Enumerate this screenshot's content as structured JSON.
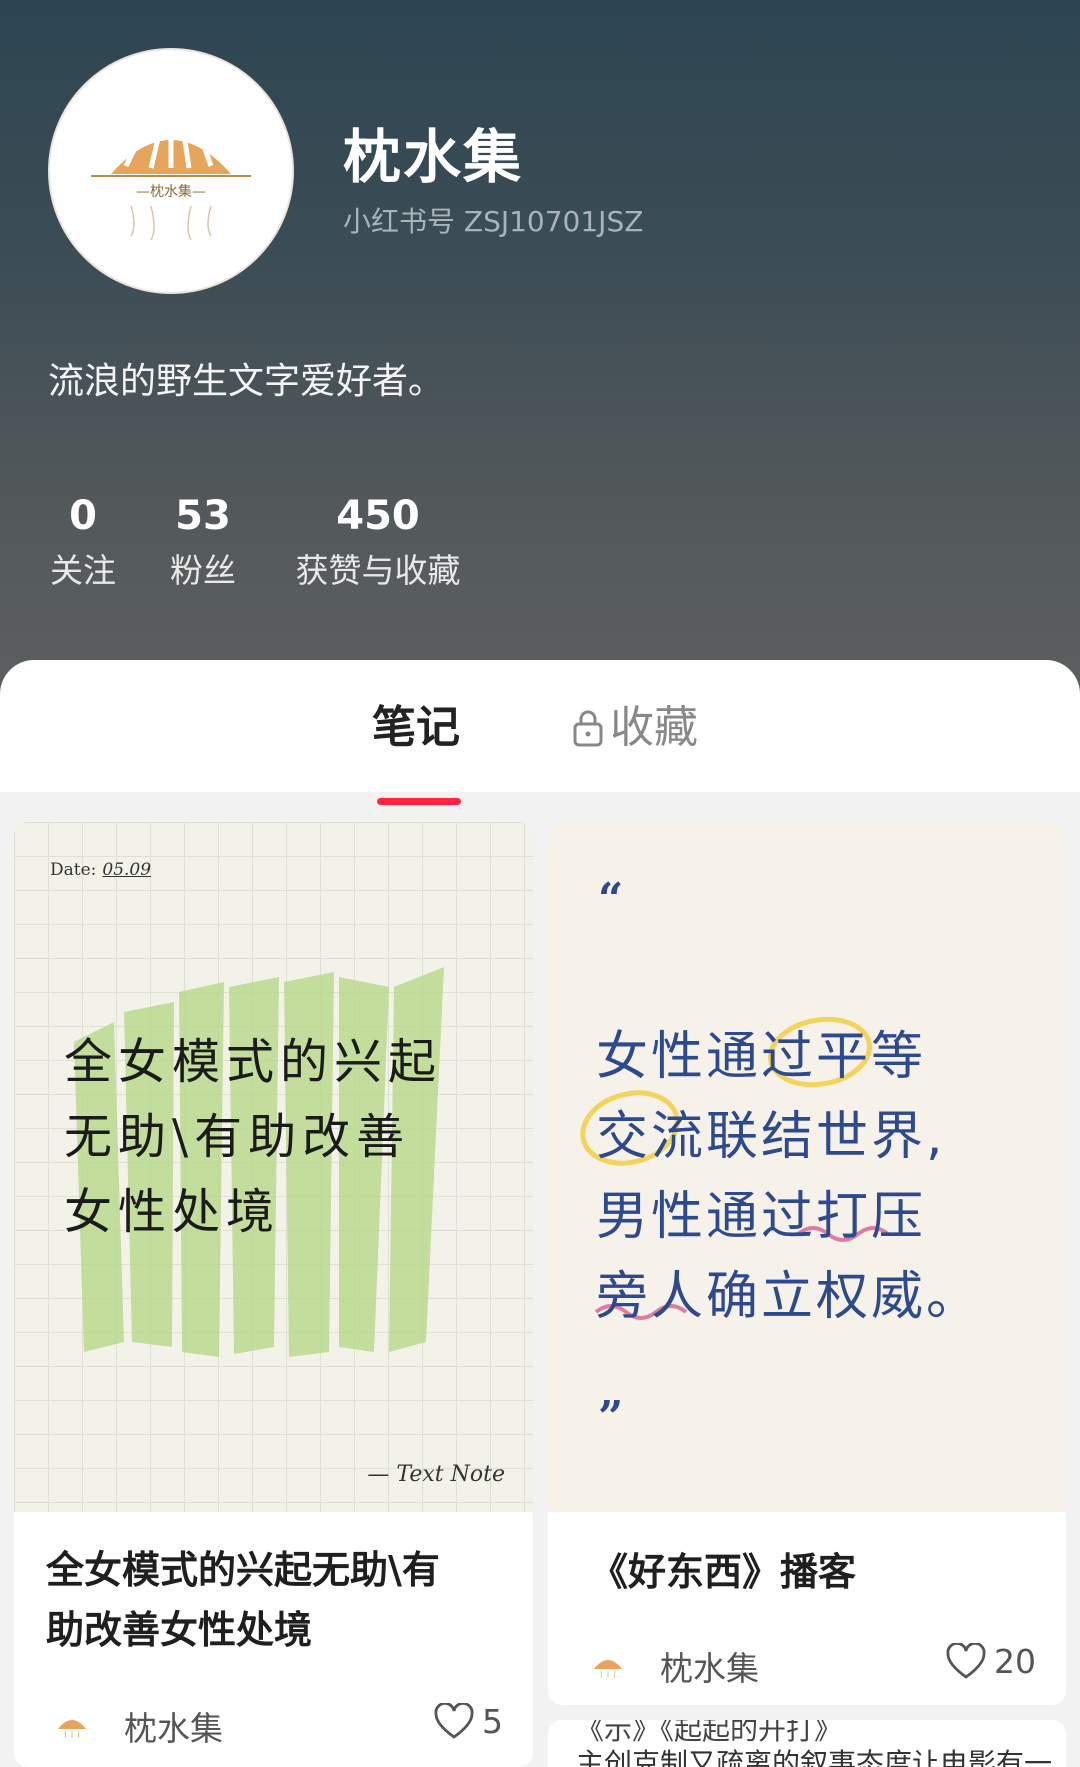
{
  "profile": {
    "nickname": "枕水集",
    "uid": "小红书号 ZSJ10701JSZ",
    "bio": "流浪的野生文字爱好者。",
    "avatar_text": "—枕水集—",
    "stats": [
      {
        "num": "0",
        "label": "关注"
      },
      {
        "num": "53",
        "label": "粉丝"
      },
      {
        "num": "450",
        "label": "获赞与收藏"
      }
    ]
  },
  "tabs": {
    "notes": "笔记",
    "collect": "收藏",
    "collect_icon": "lock-icon"
  },
  "notes": [
    {
      "cover": {
        "date_label": "Date:",
        "date_value": "05.09",
        "lines": [
          "全女模式的兴起",
          "无助\\有助改善",
          "女性处境"
        ],
        "signature": "— Text Note"
      },
      "title_lines": [
        "全女模式的兴起无助\\有",
        "助改善女性处境"
      ],
      "author": "枕水集",
      "likes": "5"
    },
    {
      "cover": {
        "open_quote": "“",
        "lines": [
          "女性通过平等",
          "交流联结世界,",
          "男性通过打压",
          "旁人确立权威。"
        ],
        "close_quote": "”"
      },
      "title_lines": [
        "《好东西》播客"
      ],
      "author": "枕水集",
      "likes": "20"
    },
    {
      "teaser_top": "《示》《起起的开打》",
      "teaser": "主创克制又疏离的叙事态度让电影有一"
    }
  ],
  "colors": {
    "accent": "#ff2442",
    "quote_blue": "#2e4a8e",
    "highlight_green": "#b6d98a",
    "circle_yellow": "#f2d45c",
    "wave_pink": "#e07aa0",
    "logo_orange": "#e6a55a"
  }
}
